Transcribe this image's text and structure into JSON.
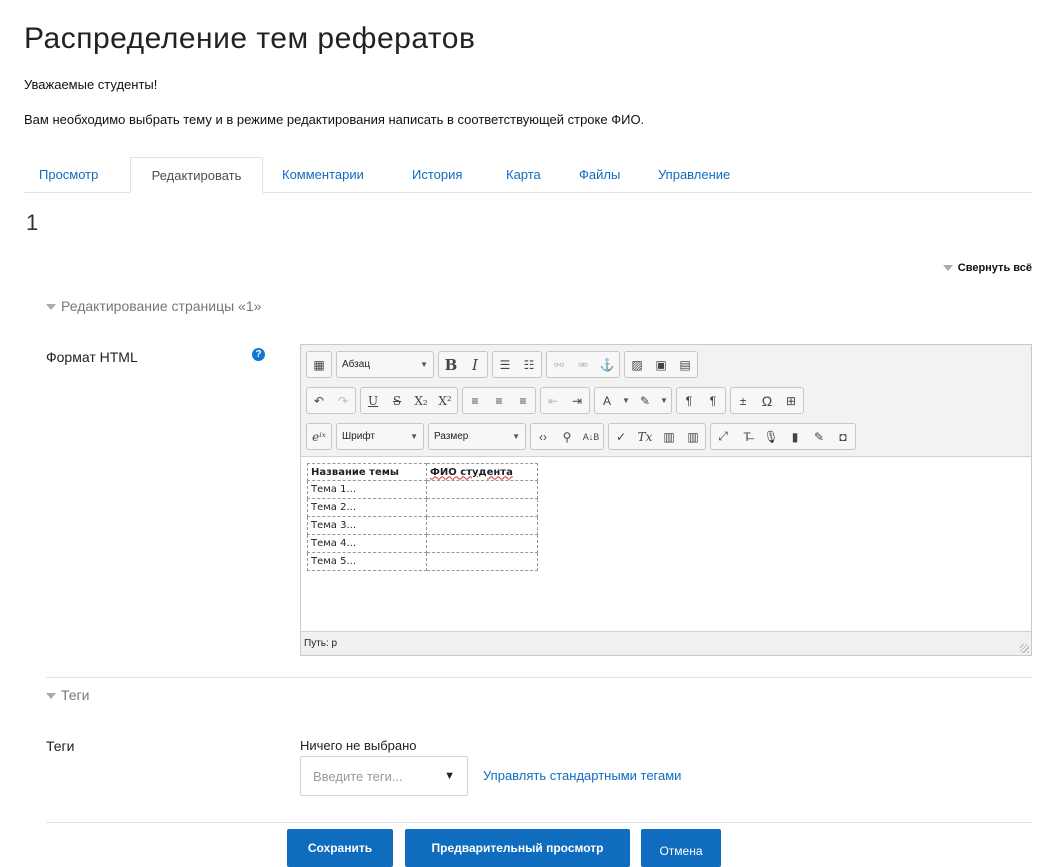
{
  "page": {
    "title": "Распределение тем рефератов",
    "intro_line1": "Уважаемые студенты!",
    "intro_line2": "Вам необходимо выбрать тему и в режиме редактирования написать в соответствующей строке ФИО.",
    "page_number": "1",
    "collapse_all": "Свернуть всё"
  },
  "tabs": [
    {
      "label": "Просмотр",
      "active": false
    },
    {
      "label": "Редактировать",
      "active": true
    },
    {
      "label": "Комментарии",
      "active": false
    },
    {
      "label": "История",
      "active": false
    },
    {
      "label": "Карта",
      "active": false
    },
    {
      "label": "Файлы",
      "active": false
    },
    {
      "label": "Управление",
      "active": false
    }
  ],
  "edit_section": {
    "heading": "Редактирование страницы «1»",
    "format_label": "Формат HTML"
  },
  "editor": {
    "paragraph_combo": "Абзац",
    "font_combo": "Шрифт",
    "size_combo": "Размер",
    "status_path": "Путь: p",
    "table": {
      "headers": [
        "Название темы",
        "ФИО студента"
      ],
      "rows": [
        [
          "Тема 1...",
          ""
        ],
        [
          "Тема 2...",
          ""
        ],
        [
          "Тема 3...",
          ""
        ],
        [
          "Тема 4...",
          ""
        ],
        [
          "Тема 5...",
          ""
        ]
      ]
    }
  },
  "tags_section": {
    "heading": "Теги",
    "label": "Теги",
    "selected_text": "Ничего не выбрано",
    "placeholder": "Введите теги...",
    "manage_link": "Управлять стандартными тегами"
  },
  "buttons": {
    "save": "Сохранить",
    "preview": "Предварительный просмотр",
    "cancel": "Отмена"
  },
  "colors": {
    "accent": "#0f6cbf",
    "help_icon": "#1177d1"
  }
}
